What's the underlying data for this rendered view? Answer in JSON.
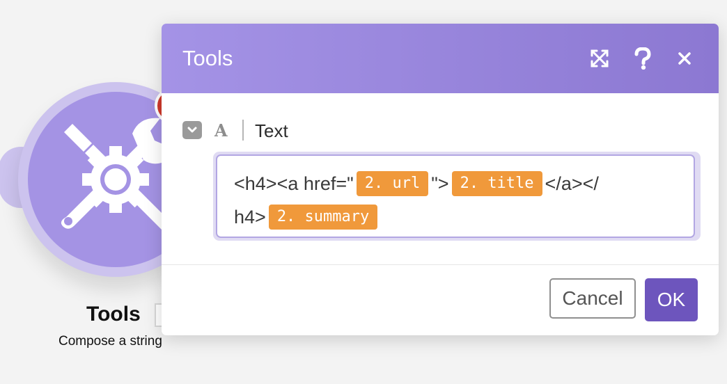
{
  "module": {
    "title": "Tools",
    "subtitle": "Compose a string",
    "icon": "tools-gear-icon",
    "colors": {
      "circle": "#a493e4",
      "halo": "#ccc3ee",
      "badge": "#d0392b"
    }
  },
  "dialog": {
    "title": "Tools",
    "header_icons": [
      "expand-icon",
      "help-icon",
      "close-icon"
    ],
    "field": {
      "type_icon_glyph": "A",
      "label": "Text",
      "value": {
        "line1": {
          "prefix": "<h4><a href=\"",
          "tag_url": "2. url",
          "middle": "\">",
          "tag_title": "2. title",
          "suffix": "</a></"
        },
        "line2": {
          "prefix": "h4>",
          "tag_summary": "2. summary"
        }
      }
    },
    "buttons": {
      "cancel": "Cancel",
      "ok": "OK"
    },
    "colors": {
      "header_start": "#a493e6",
      "header_end": "#8c78d2",
      "tag": "#f0993b",
      "primary": "#6d55bd"
    }
  }
}
